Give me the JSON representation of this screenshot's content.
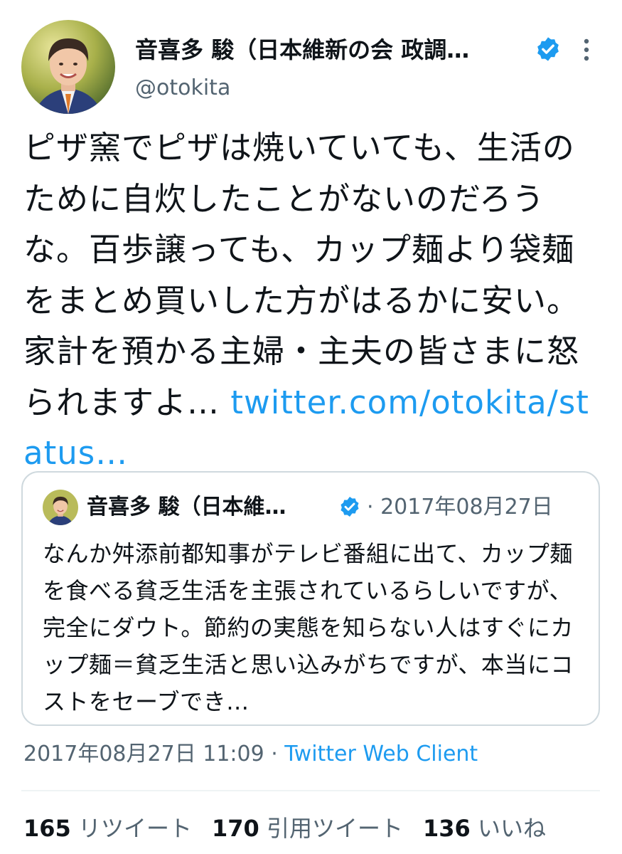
{
  "author": {
    "display_name": "音喜多 駿（日本維新の会 政調…",
    "handle": "@otokita"
  },
  "tweet": {
    "text": "ピザ窯でピザは焼いていても、生活のために自炊したことがないのだろうな。百歩譲っても、カップ麺より袋麺をまとめ買いした方がはるかに安い。家計を預かる主婦・主夫の皆さまに怒られますよ…",
    "link": "twitter.com/otokita/status…"
  },
  "quote": {
    "display_name": "音喜多 駿（日本維…",
    "date": "· 2017年08月27日",
    "text": "なんか舛添前都知事がテレビ番組に出て、カップ麺を食べる貧乏生活を主張されているらしいですが、完全にダウト。節約の実態を知らない人はすぐにカップ麺＝貧乏生活と思い込みがちですが、本当にコストをセーブでき…"
  },
  "meta": {
    "timestamp": "2017年08月27日 11:09",
    "separator": " · ",
    "client": "Twitter Web Client"
  },
  "stats": {
    "retweets_count": "165",
    "retweets_label": "リツイート",
    "quotes_count": "170",
    "quotes_label": "引用ツイート",
    "likes_count": "136",
    "likes_label": "いいね"
  },
  "icons": {
    "verified": "verified-badge-icon",
    "more": "more-vertical-icon"
  },
  "colors": {
    "link": "#1d9bf0",
    "verified": "#1d9bf0",
    "secondary_text": "#536471",
    "border": "#cfd9de"
  }
}
